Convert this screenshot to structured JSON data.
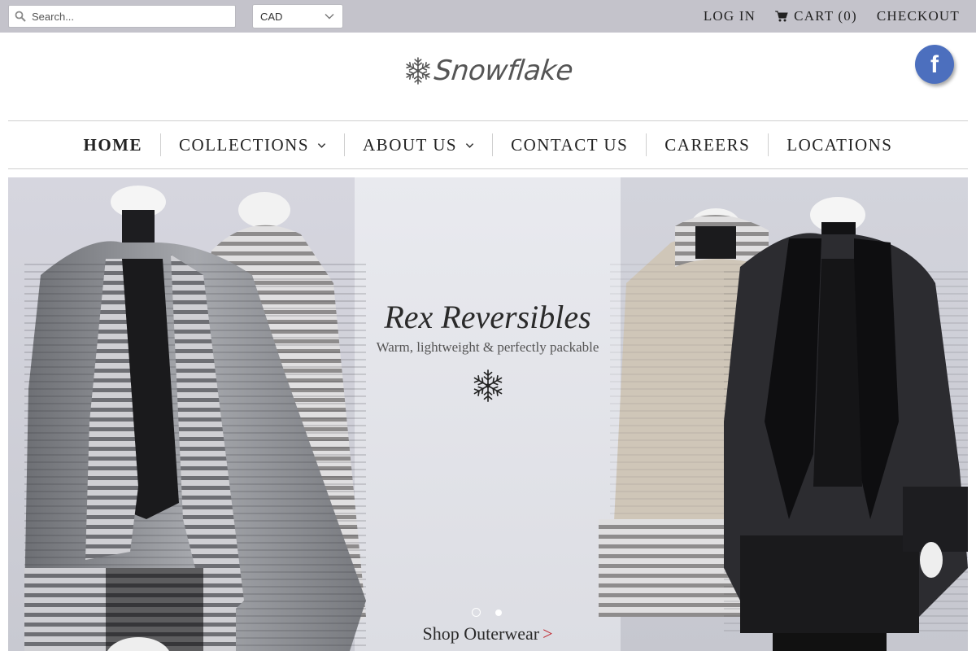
{
  "topbar": {
    "search_placeholder": "Search...",
    "currency": "CAD",
    "login": "LOG IN",
    "cart": "CART (0)",
    "checkout": "CHECKOUT",
    "bg_color": "#c4c3cb"
  },
  "header": {
    "logo_text": "Snowflake",
    "social": {
      "name": "facebook-icon",
      "glyph": "f",
      "color": "#4c6fbe"
    }
  },
  "nav": {
    "items": [
      {
        "label": "HOME",
        "dropdown": false
      },
      {
        "label": "COLLECTIONS",
        "dropdown": true
      },
      {
        "label": "ABOUT US",
        "dropdown": true
      },
      {
        "label": "CONTACT US",
        "dropdown": false
      },
      {
        "label": "CAREERS",
        "dropdown": false
      },
      {
        "label": "LOCATIONS",
        "dropdown": false
      }
    ]
  },
  "hero": {
    "title": "Rex Reversibles",
    "subtitle": "Warm, lightweight & perfectly packable",
    "cta": "Shop Outerwear",
    "cta_arrow": ">",
    "slides": 2,
    "active_slide": 1
  }
}
